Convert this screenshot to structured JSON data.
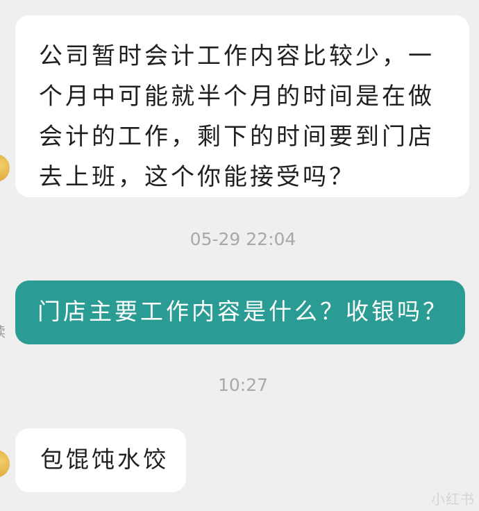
{
  "messages": [
    {
      "direction": "incoming",
      "text": "公司暂时会计工作内容比较少，一个月中可能就半个月的时间是在做会计的工作，剩下的时间要到门店去上班，这个你能接受吗？"
    },
    {
      "direction": "outgoing",
      "text": "门店主要工作内容是什么？收银吗？",
      "read_label": "读"
    },
    {
      "direction": "incoming",
      "text": "包馄饨水饺"
    }
  ],
  "timestamps": [
    "05-29 22:04",
    "10:27"
  ],
  "watermark": "小红书",
  "colors": {
    "background": "#efefef",
    "incoming_bubble": "#ffffff",
    "outgoing_bubble": "#2b9c93",
    "timestamp": "#a8a8a8"
  }
}
